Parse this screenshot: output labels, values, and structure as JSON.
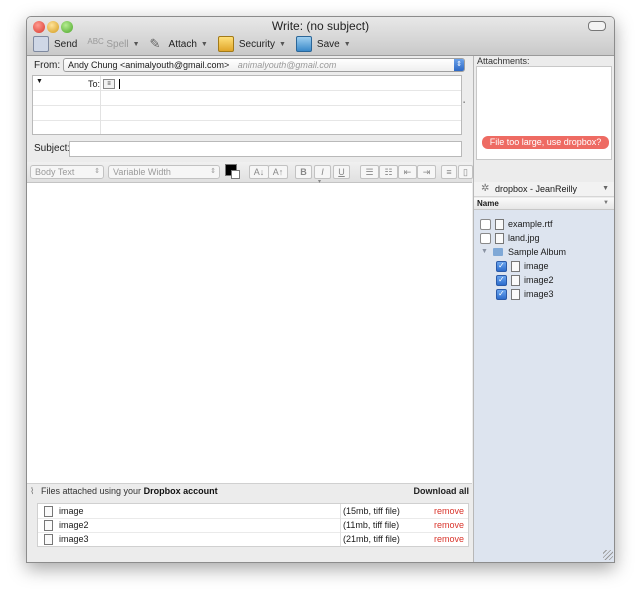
{
  "window": {
    "title": "Write: (no subject)"
  },
  "toolbar": {
    "send": "Send",
    "spell": "Spell",
    "attach": "Attach",
    "security": "Security",
    "save": "Save"
  },
  "compose": {
    "from_label": "From:",
    "from_value": "Andy Chung <animalyouth@gmail.com>",
    "from_sub": "animalyouth@gmail.com",
    "to_label": "To:",
    "subject_label": "Subject:"
  },
  "format": {
    "style": "Body Text",
    "font": "Variable Width",
    "btn_smaller": "A↓",
    "btn_larger": "A↑",
    "bold": "B",
    "italic": "I",
    "underline": "U"
  },
  "attachments_panel": {
    "label": "Attachments:",
    "warning": "File too large, use dropbox?"
  },
  "dropbox": {
    "account": "dropbox - JeanReilly",
    "column": "Name",
    "items": [
      {
        "name": "example.rtf",
        "checked": false
      },
      {
        "name": "land.jpg",
        "checked": false
      },
      {
        "name": "Sample Album",
        "folder": true
      },
      {
        "name": "image",
        "checked": true
      },
      {
        "name": "image2",
        "checked": true
      },
      {
        "name": "image3",
        "checked": true
      }
    ]
  },
  "attach_bar": {
    "prefix": "Files attached using your",
    "service": "Dropbox account",
    "download_all": "Download all"
  },
  "attached_files": [
    {
      "name": "image",
      "size": "(15mb, tiff file)",
      "action": "remove"
    },
    {
      "name": "image2",
      "size": "(11mb, tiff file)",
      "action": "remove"
    },
    {
      "name": "image3",
      "size": "(21mb, tiff file)",
      "action": "remove"
    }
  ],
  "colors": {
    "remove": "#d9342b",
    "warning": "#ee6b63",
    "tree_bg": "#dde4ef"
  }
}
